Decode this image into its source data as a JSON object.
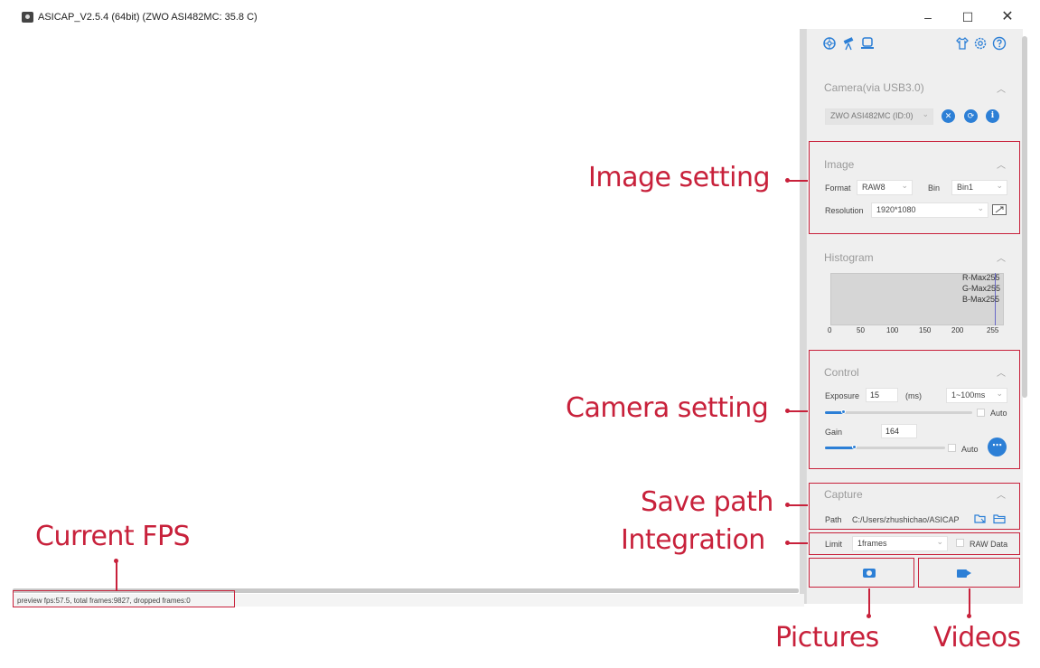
{
  "window": {
    "title": "ASICAP_V2.5.4 (64bit) (ZWO ASI482MC: 35.8 C)",
    "controls": [
      "–",
      "☐",
      "✕"
    ]
  },
  "toolbar": {
    "icons_left": [
      "aperture-icon",
      "telescope-icon",
      "monitor-icon"
    ],
    "icons_right": [
      "shirt-icon",
      "gear-icon",
      "help-icon"
    ]
  },
  "camera": {
    "title": "Camera(via USB3.0)",
    "device": "ZWO ASI482MC (ID:0)"
  },
  "image": {
    "title": "Image",
    "format_label": "Format",
    "format_value": "RAW8",
    "bin_label": "Bin",
    "bin_value": "Bin1",
    "resolution_label": "Resolution",
    "resolution_value": "1920*1080"
  },
  "histogram": {
    "title": "Histogram",
    "legend": [
      "R-Max255",
      "G-Max255",
      "B-Max255"
    ],
    "ticks": [
      "0",
      "50",
      "100",
      "150",
      "200",
      "255"
    ]
  },
  "control": {
    "title": "Control",
    "exposure_label": "Exposure",
    "exposure_value": "15",
    "exposure_unit": "(ms)",
    "exposure_range": "1~100ms",
    "exposure_auto": "Auto",
    "exposure_level": 0.13,
    "gain_label": "Gain",
    "gain_value": "164",
    "gain_auto": "Auto",
    "gain_level": 0.25
  },
  "capture": {
    "title": "Capture",
    "path_label": "Path",
    "path_value": "C:/Users/zhushichao/ASICAP",
    "limit_label": "Limit",
    "limit_value": "1frames",
    "raw_label": "RAW Data"
  },
  "status": {
    "text": "preview fps:57.5, total frames:9827, dropped frames:0"
  },
  "annotations": {
    "image_setting": "Image setting",
    "camera_setting": "Camera setting",
    "save_path": "Save path",
    "integration": "Integration",
    "current_fps": "Current FPS",
    "pictures": "Pictures",
    "videos": "Videos"
  },
  "colors": {
    "accent": "#2c7fd6",
    "annotation": "#c8213b",
    "panel": "#efefef"
  }
}
